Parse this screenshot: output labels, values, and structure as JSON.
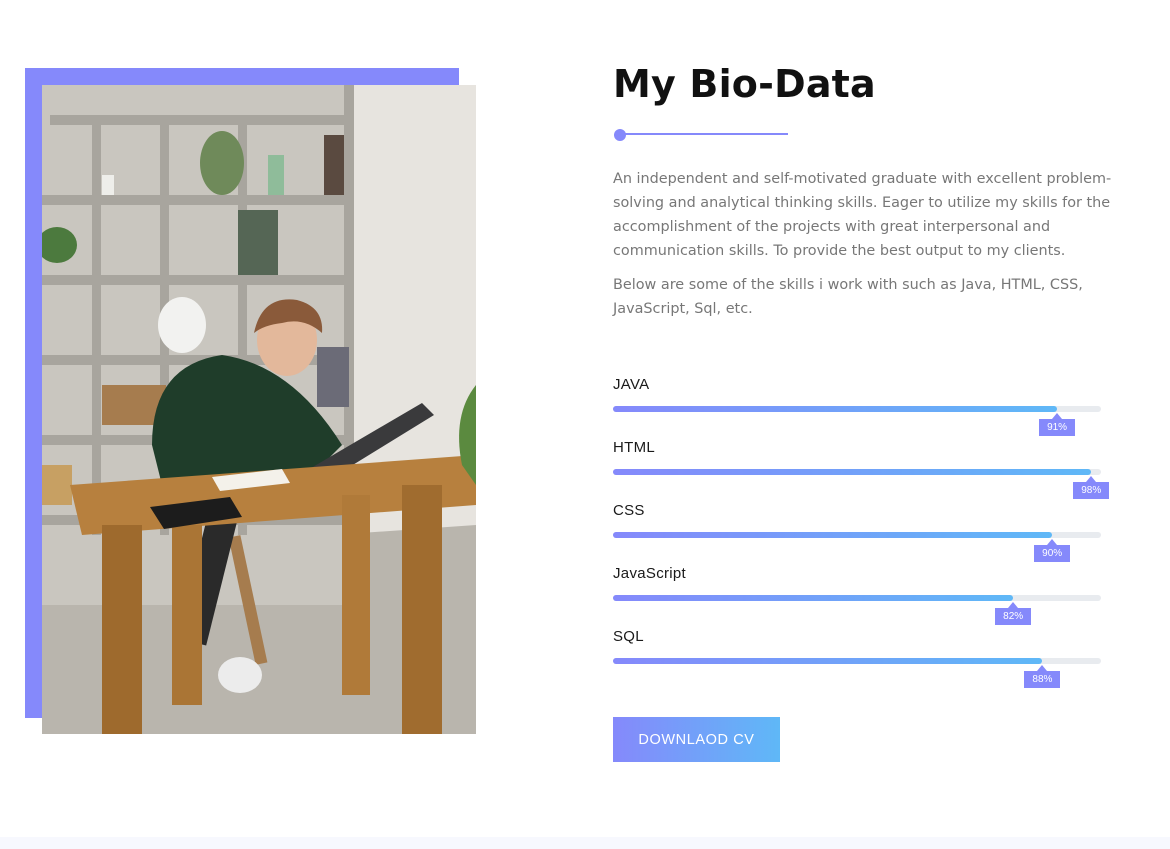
{
  "bio": {
    "title": "My Bio-Data",
    "paragraph_1": "An independent and self-motivated graduate with excellent problem-solving and analytical thinking skills. Eager to utilize my skills for the accomplishment of the projects with great interpersonal and communication skills. To provide the best output to my clients.",
    "paragraph_2": "Below are some of the skills i work with such as Java, HTML, CSS, JavaScript, Sql, etc."
  },
  "skills": [
    {
      "name": "JAVA",
      "percent": 91,
      "label": "91%"
    },
    {
      "name": "HTML",
      "percent": 98,
      "label": "98%"
    },
    {
      "name": "CSS",
      "percent": 90,
      "label": "90%"
    },
    {
      "name": "JavaScript",
      "percent": 82,
      "label": "82%"
    },
    {
      "name": "SQL",
      "percent": 88,
      "label": "88%"
    }
  ],
  "download_button": {
    "label": "DOWNLAOD CV"
  },
  "colors": {
    "accent": "#8589fb",
    "accent_gradient_end": "#5fb8f7",
    "track": "#e8ebef",
    "heading": "#111111",
    "body_text": "#777777"
  }
}
